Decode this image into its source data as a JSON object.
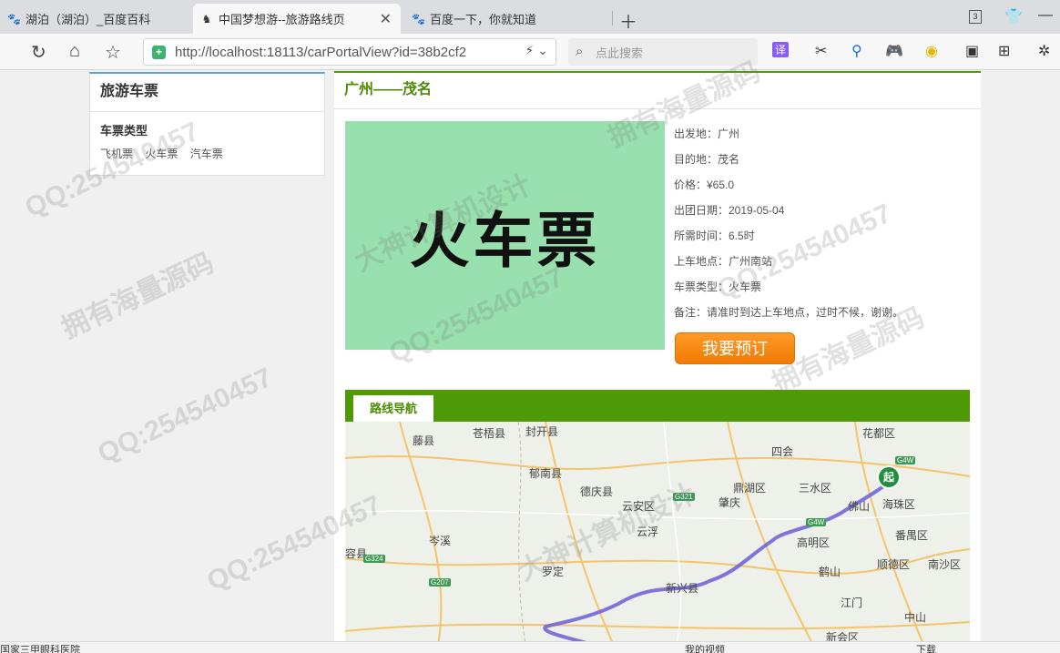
{
  "tabs": [
    {
      "title": "湖泊（湖泊）_百度百科",
      "icon": "paw-icon"
    },
    {
      "title": "中国梦想游--旅游路线页",
      "icon": "horse-icon",
      "active": true
    },
    {
      "title": "百度一下，你就知道",
      "icon": "paw-icon"
    }
  ],
  "tab_count": "3",
  "address": {
    "url": "http://localhost:18113/carPortalView?id=38b2cf2",
    "search_placeholder": "点此搜索"
  },
  "toolbar": {
    "translate": "译"
  },
  "sidebar": {
    "title": "旅游车票",
    "category_title": "车票类型",
    "links": [
      "飞机票",
      "火车票",
      "汽车票"
    ]
  },
  "route": {
    "title": "广州——茂名",
    "image_text": "火车票",
    "details": [
      "出发地：广州",
      "目的地：茂名",
      "价格：¥65.0",
      "出团日期：2019-05-04",
      "所需时间：6.5时",
      "上车地点：广州南站",
      "车票类型：火车票",
      "备注：请准时到达上车地点，过时不候，谢谢。"
    ],
    "book_button": "我要预订"
  },
  "nav_tab": "路线导航",
  "map": {
    "start_marker": "起",
    "places": [
      {
        "name": "藤县"
      },
      {
        "name": "苍梧县"
      },
      {
        "name": "封开县"
      },
      {
        "name": "郁南县"
      },
      {
        "name": "德庆县"
      },
      {
        "name": "云安区"
      },
      {
        "name": "云浮"
      },
      {
        "name": "岑溪"
      },
      {
        "name": "容县"
      },
      {
        "name": "罗定"
      },
      {
        "name": "新兴县"
      },
      {
        "name": "四会"
      },
      {
        "name": "鼎湖区"
      },
      {
        "name": "肇庆"
      },
      {
        "name": "三水区"
      },
      {
        "name": "花都区"
      },
      {
        "name": "佛山"
      },
      {
        "name": "海珠区"
      },
      {
        "name": "高明区"
      },
      {
        "name": "番禺区"
      },
      {
        "name": "鹤山"
      },
      {
        "name": "顺德区"
      },
      {
        "name": "南沙区"
      },
      {
        "name": "江门"
      },
      {
        "name": "中山"
      },
      {
        "name": "新会区"
      }
    ],
    "roads": [
      "G4W",
      "G321",
      "G4W",
      "G324",
      "G207"
    ]
  },
  "statusbar": {
    "left": "国家三甲眼科医院",
    "video": "我的视频",
    "download": "下载"
  },
  "watermarks": [
    "QQ:254540457",
    "拥有海量源码",
    "大神计算机设计"
  ]
}
